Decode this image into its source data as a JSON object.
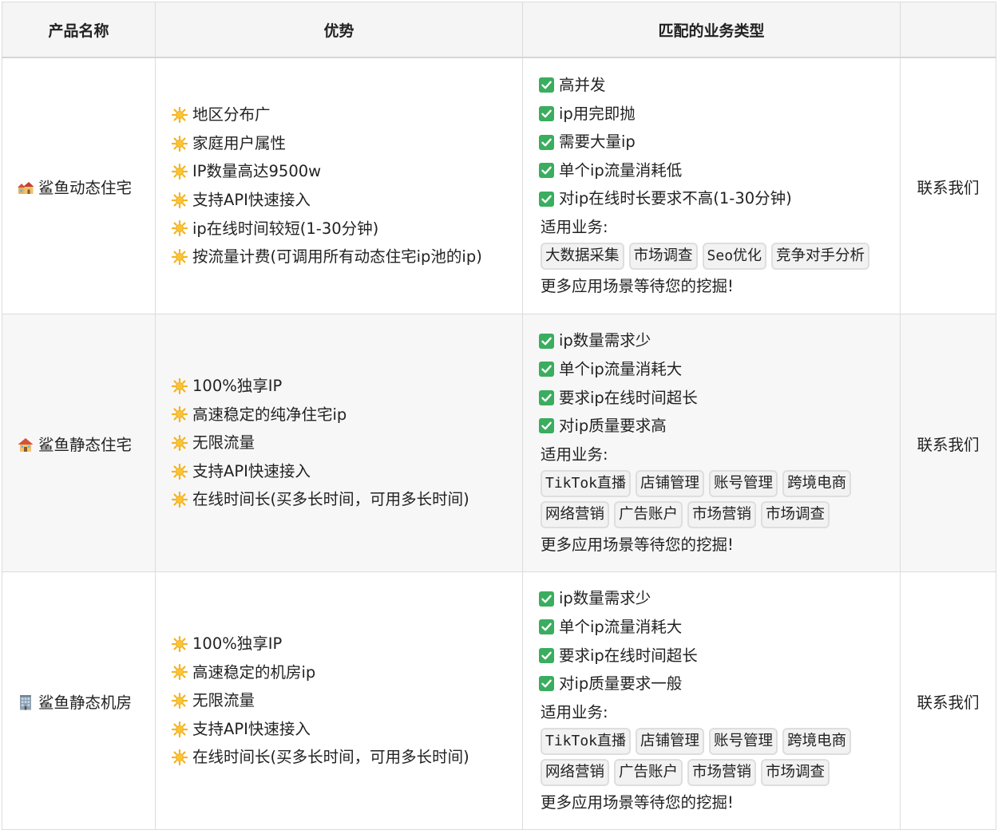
{
  "headers": {
    "name": "产品名称",
    "advantage": "优势",
    "match": "匹配的业务类型",
    "extra": ""
  },
  "rows": [
    {
      "name": "鲨鱼动态住宅",
      "name_icon": "houses-icon",
      "advantages": [
        "地区分布广",
        "家庭用户属性",
        "IP数量高达9500w",
        "支持API快速接入",
        "ip在线时间较短(1-30分钟)",
        "按流量计费(可调用所有动态住宅ip池的ip)"
      ],
      "checks": [
        "高并发",
        "ip用完即抛",
        "需要大量ip",
        "单个ip流量消耗低",
        "对ip在线时长要求不高(1-30分钟)"
      ],
      "apply_label": "适用业务:",
      "tags": [
        "大数据采集",
        "市场调查",
        "Seo优化",
        "竞争对手分析"
      ],
      "more": "更多应用场景等待您的挖掘!",
      "contact": "联系我们"
    },
    {
      "name": "鲨鱼静态住宅",
      "name_icon": "house-icon",
      "advantages": [
        "100%独享IP",
        "高速稳定的纯净住宅ip",
        "无限流量",
        "支持API快速接入",
        "在线时间长(买多长时间，可用多长时间)"
      ],
      "checks": [
        "ip数量需求少",
        "单个ip流量消耗大",
        "要求ip在线时间超长",
        "对ip质量要求高"
      ],
      "apply_label": "适用业务:",
      "tags": [
        "TikTok直播",
        "店铺管理",
        "账号管理",
        "跨境电商",
        "网络营销",
        "广告账户",
        "市场营销",
        "市场调查"
      ],
      "more": "更多应用场景等待您的挖掘!",
      "contact": "联系我们"
    },
    {
      "name": "鲨鱼静态机房",
      "name_icon": "office-building-icon",
      "advantages": [
        "100%独享IP",
        "高速稳定的机房ip",
        "无限流量",
        "支持API快速接入",
        "在线时间长(买多长时间，可用多长时间)"
      ],
      "checks": [
        "ip数量需求少",
        "单个ip流量消耗大",
        "要求ip在线时间超长",
        "对ip质量要求一般"
      ],
      "apply_label": "适用业务:",
      "tags": [
        "TikTok直播",
        "店铺管理",
        "账号管理",
        "跨境电商",
        "网络营销",
        "广告账户",
        "市场营销",
        "市场调查"
      ],
      "more": "更多应用场景等待您的挖掘!",
      "contact": "联系我们"
    }
  ],
  "colors": {
    "check": "#3aad5f",
    "sun": "#f6b21b",
    "header_bg": "#f5f5f5",
    "border": "#dcdcdc"
  }
}
